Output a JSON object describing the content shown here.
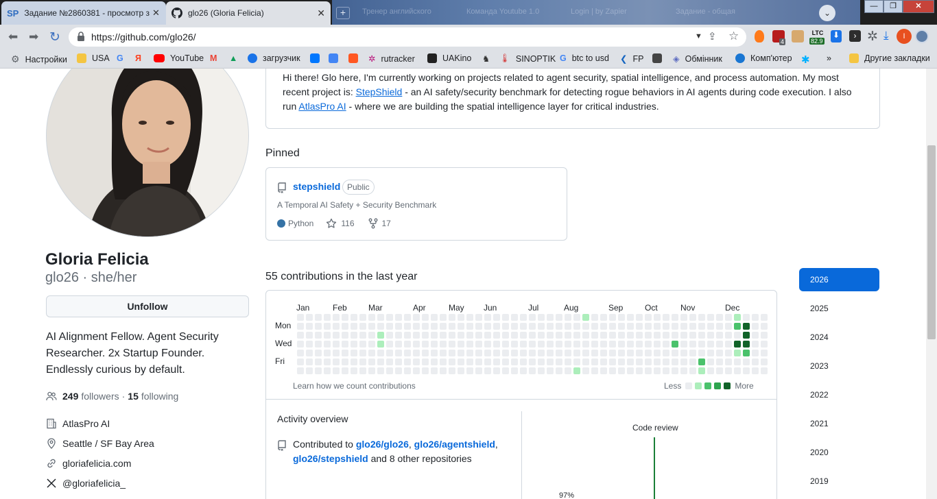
{
  "browser": {
    "tabs": [
      {
        "title": "Задание №2860381 - просмотр з",
        "favicon": "sp-icon",
        "active": false
      },
      {
        "title": "glo26 (Gloria Felicia)",
        "favicon": "github-icon",
        "active": true
      }
    ],
    "blurred_tabs": [
      "Тренер английского",
      "Команда Youtube 1.0",
      "Login | by Zapier",
      "Задание - общая"
    ],
    "window_buttons": [
      "—",
      "❐",
      "✕"
    ],
    "profile_letter": "",
    "url": "https://github.com/glo26/",
    "extension_badges": {
      "counter": "4",
      "ltc_label": "LTC",
      "ltc_value": "82.9",
      "profile": "I"
    },
    "bookmarks": [
      {
        "label": "Настройки",
        "color": "#5f6368"
      },
      {
        "label": "USA",
        "color": "#f4c542"
      },
      {
        "label": "",
        "color": "#4285f4"
      },
      {
        "label": "",
        "color": "#fc3f1d"
      },
      {
        "label": "YouTube",
        "color": "#ff0000"
      },
      {
        "label": "",
        "color": "#ea4335"
      },
      {
        "label": "",
        "color": "#0f9d58"
      },
      {
        "label": "загрузчик",
        "color": "#1a73e8"
      },
      {
        "label": "",
        "color": "#0077ff"
      },
      {
        "label": "",
        "color": "#4285f4"
      },
      {
        "label": "",
        "color": "#ff5722"
      },
      {
        "label": "rutracker",
        "color": "#2e7d32"
      },
      {
        "label": "UAKino",
        "color": "#222222"
      },
      {
        "label": "",
        "color": "#333333"
      },
      {
        "label": "SINOPTIK",
        "color": "#d32f2f"
      },
      {
        "label": "btc to usd",
        "color": "#4285f4"
      },
      {
        "label": "FP",
        "color": "#1565c0"
      },
      {
        "label": "",
        "color": "#444444"
      },
      {
        "label": "Обмінник",
        "color": "#5c6bc0"
      },
      {
        "label": "Комп'ютер",
        "color": "#1976d2"
      },
      {
        "label": "",
        "color": "#00b0ff"
      }
    ],
    "more_bookmarks": "»",
    "other_bookmarks": "Другие закладки"
  },
  "profile": {
    "name": "Gloria Felicia",
    "login_line": "glo26 · she/her",
    "follow_button": "Unfollow",
    "bio": "AI Alignment Fellow. Agent Security Researcher. 2x Startup Founder. Endlessly curious by default.",
    "followers_count": "249",
    "followers_label": "followers",
    "following_count": "15",
    "following_label": "following",
    "separator": "·",
    "company": "AtlasPro AI",
    "location": "Seattle / SF Bay Area",
    "website": "gloriafelicia.com",
    "twitter": "@gloriafelicia_"
  },
  "readme": {
    "text1": "Hi there! Glo here, I'm currently working on projects related to agent security, spatial intelligence, and process automation. My most recent project is: ",
    "link1": "StepShield",
    "text2": " - an AI safety/security benchmark for detecting rogue behaviors in AI agents during code execution. I also run ",
    "link2": "AtlasPro AI",
    "text3": " - where we are building the spatial intelligence layer for critical industries."
  },
  "pinned": {
    "heading": "Pinned",
    "repo": "stepshield",
    "visibility": "Public",
    "description": "A Temporal AI Safety + Security Benchmark",
    "language": "Python",
    "stars": "116",
    "forks": "17"
  },
  "contributions": {
    "heading": "55 contributions in the last year",
    "months": [
      "Jan",
      "Feb",
      "Mar",
      "Apr",
      "May",
      "Jun",
      "Jul",
      "Aug",
      "Sep",
      "Oct",
      "Nov",
      "Dec"
    ],
    "day_labels": [
      "Mon",
      "Wed",
      "Fri"
    ],
    "learn_link": "Learn how we count contributions",
    "legend_less": "Less",
    "legend_more": "More",
    "level_colors": [
      "#ebedf0",
      "#aceebb",
      "#4ac26b",
      "#2da44e",
      "#116329"
    ],
    "active_cells": [
      {
        "week": 9,
        "day": 2,
        "level": 1
      },
      {
        "week": 9,
        "day": 3,
        "level": 1
      },
      {
        "week": 32,
        "day": 0,
        "level": 1
      },
      {
        "week": 31,
        "day": 6,
        "level": 1
      },
      {
        "week": 42,
        "day": 3,
        "level": 2
      },
      {
        "week": 45,
        "day": 5,
        "level": 2
      },
      {
        "week": 45,
        "day": 6,
        "level": 1
      },
      {
        "week": 49,
        "day": 0,
        "level": 1
      },
      {
        "week": 49,
        "day": 1,
        "level": 2
      },
      {
        "week": 49,
        "day": 3,
        "level": 4
      },
      {
        "week": 49,
        "day": 4,
        "level": 1
      },
      {
        "week": 50,
        "day": 1,
        "level": 4
      },
      {
        "week": 50,
        "day": 2,
        "level": 4
      },
      {
        "week": 50,
        "day": 3,
        "level": 4
      },
      {
        "week": 50,
        "day": 4,
        "level": 2
      }
    ]
  },
  "activity": {
    "heading": "Activity overview",
    "contributed_to": "Contributed to",
    "repo1": "glo26/glo26",
    "repo2": "glo26/agentshield",
    "repo3": "glo26/stepshield",
    "other": "and 8 other repositories",
    "code_review_label": "Code review",
    "percent_label": "97%"
  },
  "years": [
    "2026",
    "2025",
    "2024",
    "2023",
    "2022",
    "2021",
    "2020",
    "2019"
  ],
  "selected_year": "2026"
}
